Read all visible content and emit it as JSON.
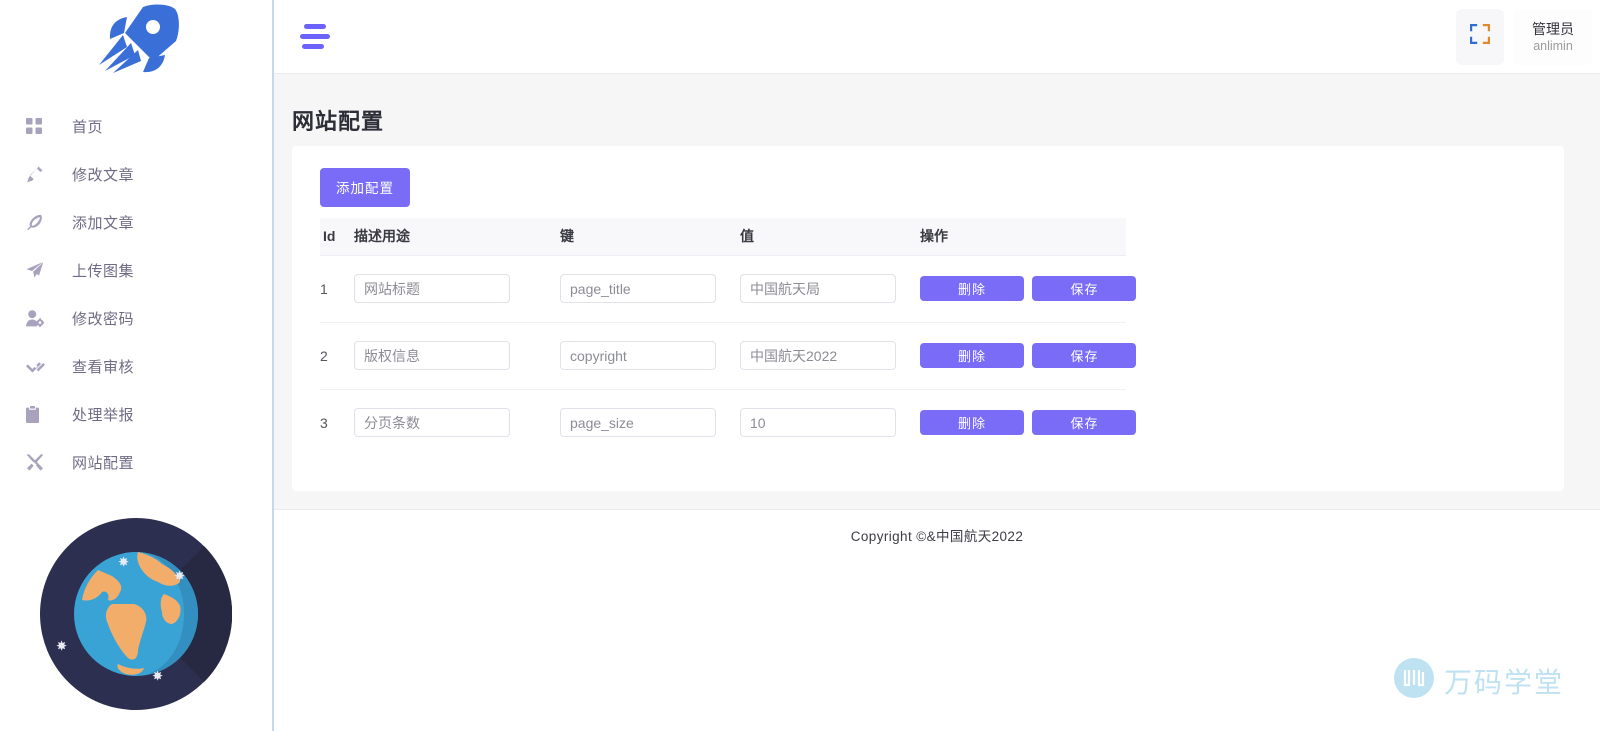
{
  "app": {
    "logo_icon": "rocket-icon",
    "accent_color": "#7a6cf7",
    "sidebar_icon_color": "#a9a2bd"
  },
  "sidebar": {
    "items": [
      {
        "label": "首页",
        "icon": "grid-icon"
      },
      {
        "label": "修改文章",
        "icon": "pencil-icon"
      },
      {
        "label": "添加文章",
        "icon": "feather-icon"
      },
      {
        "label": "上传图集",
        "icon": "send-icon"
      },
      {
        "label": "修改密码",
        "icon": "user-gear-icon"
      },
      {
        "label": "查看审核",
        "icon": "double-check-icon"
      },
      {
        "label": "处理举报",
        "icon": "clipboard-icon"
      },
      {
        "label": "网站配置",
        "icon": "tools-icon"
      }
    ],
    "illustration": "earth-globe-illustration"
  },
  "topbar": {
    "menu_toggle_icon": "hamburger-menu-icon",
    "fullscreen_icon": "fullscreen-expand-icon",
    "user_name": "管理员",
    "user_login": "anlimin"
  },
  "page": {
    "title": "网站配置"
  },
  "toolbar": {
    "add_label": "添加配置"
  },
  "table": {
    "headers": {
      "id": "Id",
      "desc": "描述用途",
      "key": "键",
      "value": "值",
      "op": "操作"
    },
    "rows": [
      {
        "id": "1",
        "desc": "网站标题",
        "key": "page_title",
        "value": "中国航天局",
        "delete_label": "删除",
        "save_label": "保存"
      },
      {
        "id": "2",
        "desc": "版权信息",
        "key": "copyright",
        "value": "中国航天2022",
        "delete_label": "删除",
        "save_label": "保存"
      },
      {
        "id": "3",
        "desc": "分页条数",
        "key": "page_size",
        "value": "10",
        "delete_label": "删除",
        "save_label": "保存"
      }
    ]
  },
  "footer": {
    "text": "Copyright ©&中国航天2022"
  },
  "watermark": {
    "text": "万码学堂",
    "icon": "wanma-logo-icon",
    "color": "#bfe2f2"
  }
}
